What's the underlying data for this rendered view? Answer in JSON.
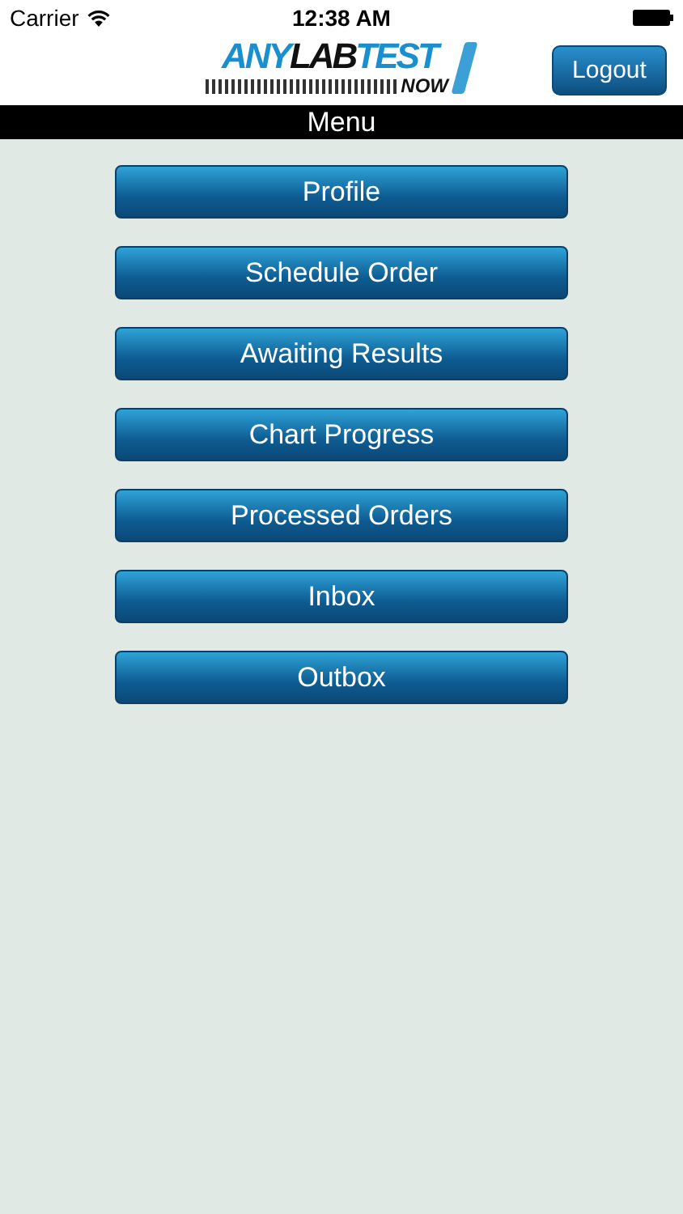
{
  "status_bar": {
    "carrier": "Carrier",
    "time": "12:38 AM"
  },
  "logo": {
    "words": [
      {
        "text": "ANY",
        "color": "#1a8fd0"
      },
      {
        "text": "LAB",
        "color": "#111111"
      },
      {
        "text": "TEST",
        "color": "#1a8fd0"
      }
    ],
    "tagline": "NOW"
  },
  "header": {
    "logout_button": "Logout"
  },
  "menu_bar": {
    "title": "Menu"
  },
  "menu_items": [
    "Profile",
    "Schedule Order",
    "Awaiting Results",
    "Chart Progress",
    "Processed Orders",
    "Inbox",
    "Outbox"
  ]
}
